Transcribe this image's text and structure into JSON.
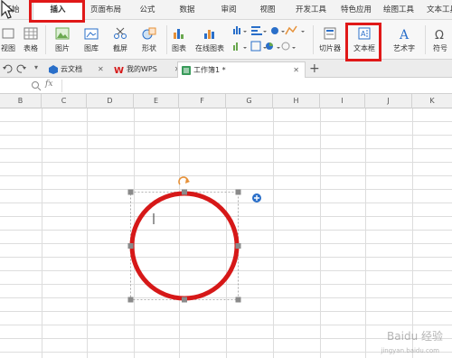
{
  "menu_tabs": [
    {
      "label": "开始"
    },
    {
      "label": "插入"
    },
    {
      "label": "页面布局"
    },
    {
      "label": "公式"
    },
    {
      "label": "数据"
    },
    {
      "label": "审阅"
    },
    {
      "label": "视图"
    },
    {
      "label": "开发工具"
    },
    {
      "label": "特色应用"
    },
    {
      "label": "绘图工具"
    },
    {
      "label": "文本工具"
    }
  ],
  "ribbon": {
    "view": "视图",
    "table": "表格",
    "picture": "图片",
    "gallery": "图库",
    "screenshot": "截屏",
    "shapes": "形状",
    "chart": "图表",
    "online_chart": "在线图表",
    "slicer": "切片器",
    "textbox": "文本框",
    "wordart": "艺术字",
    "symbol": "符号"
  },
  "doc_tabs": [
    {
      "label": "云文档"
    },
    {
      "label": "我的WPS"
    },
    {
      "label": "工作簿1 *"
    }
  ],
  "formula_bar": {
    "fx": "fx"
  },
  "columns": [
    "B",
    "C",
    "D",
    "E",
    "F",
    "G",
    "H",
    "I",
    "J",
    "K"
  ],
  "shape": {
    "type": "circle",
    "stroke": "#d61818"
  },
  "watermark": {
    "text": "Baidu 经验",
    "url": "jingyan.baidu.com"
  },
  "colors": {
    "highlight": "#e01818",
    "accent_blue": "#2a6fc9"
  }
}
